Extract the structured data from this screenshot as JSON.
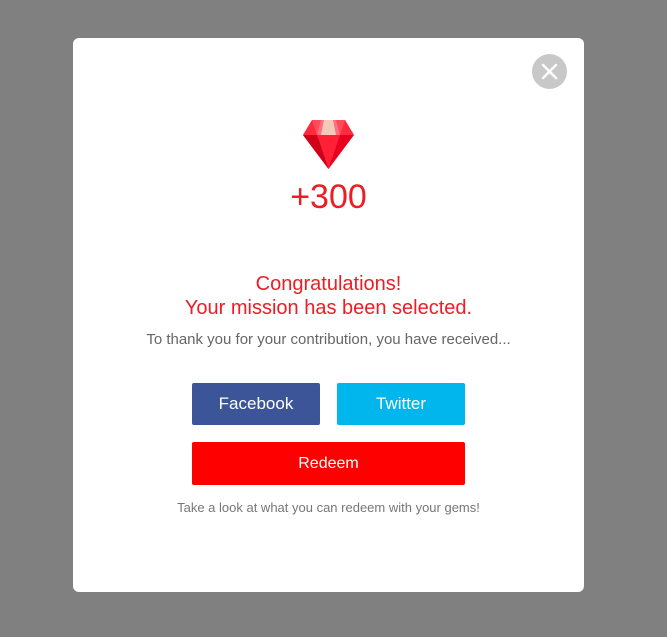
{
  "modal": {
    "close_icon": "close-icon",
    "gem_icon": "gem-icon",
    "gem_amount": "+300",
    "headline_line1": "Congratulations!",
    "headline_line2": "Your mission has been selected.",
    "subtext": "To thank you for your contribution, you have received...",
    "buttons": {
      "facebook": "Facebook",
      "twitter": "Twitter",
      "redeem": "Redeem"
    },
    "footer_note": "Take a look at what you can redeem with your gems!"
  },
  "colors": {
    "overlay": "#808080",
    "accent_red": "#ee1c25",
    "facebook": "#3b5598",
    "twitter": "#00b6ed",
    "redeem": "#ff0000",
    "close_bg": "#c8c8c8"
  }
}
